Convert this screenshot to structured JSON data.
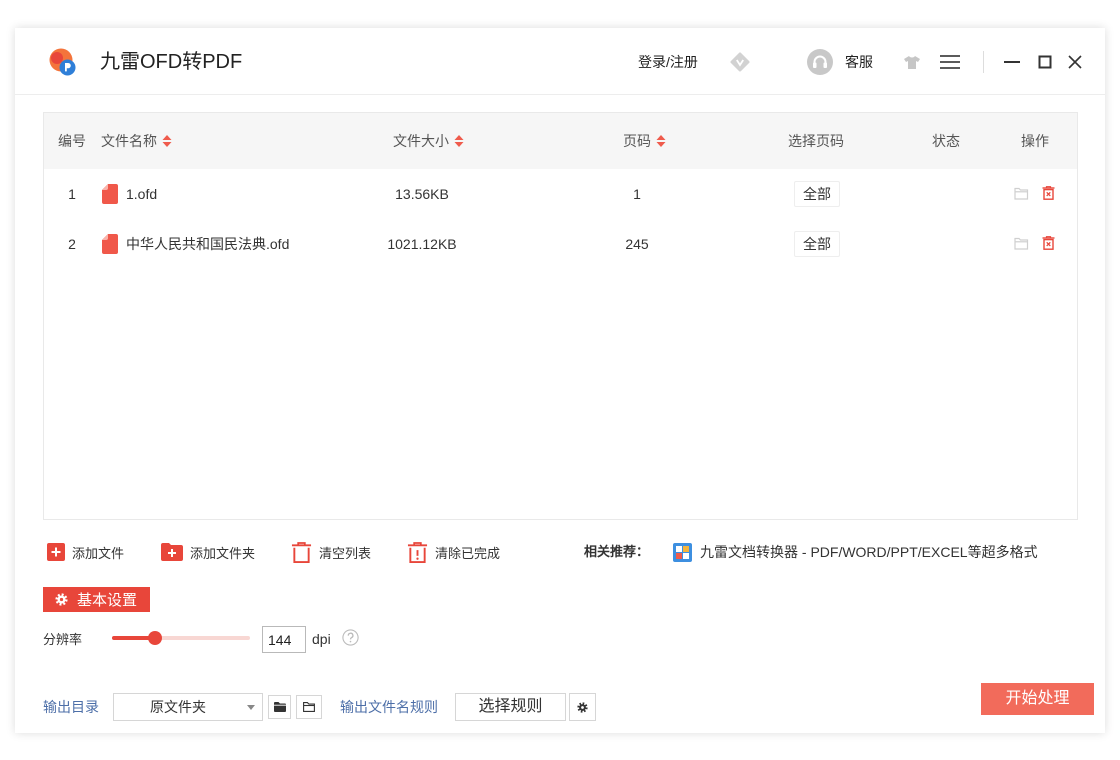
{
  "app": {
    "title": "九雷OFD转PDF",
    "logo_icon": "jiulei-ofd-logo",
    "accent_color": "#e8463a",
    "start_button_color": "#f26b5b",
    "link_color": "#4d6fa8"
  },
  "header": {
    "login_label": "登录/注册",
    "vip_icon": "diamond-vip-icon",
    "service_icon": "headset-icon",
    "service_label": "客服",
    "skin_icon": "tshirt-icon",
    "menu_icon": "menu-icon",
    "window_controls": [
      "minimize-icon",
      "maximize-icon",
      "close-icon"
    ]
  },
  "table": {
    "columns": [
      {
        "label": "编号",
        "sortable": false
      },
      {
        "label": "文件名称",
        "sortable": true
      },
      {
        "label": "文件大小",
        "sortable": true
      },
      {
        "label": "页码",
        "sortable": true
      },
      {
        "label": "选择页码",
        "sortable": false
      },
      {
        "label": "状态",
        "sortable": false
      },
      {
        "label": "操作",
        "sortable": false
      }
    ],
    "rows": [
      {
        "index": "1",
        "name": "1.ofd",
        "size": "13.56KB",
        "pages": "1",
        "page_select": "全部",
        "status": ""
      },
      {
        "index": "2",
        "name": "中华人民共和国民法典.ofd",
        "size": "1021.12KB",
        "pages": "245",
        "page_select": "全部",
        "status": ""
      }
    ],
    "file_icon": "ofd-file-icon",
    "row_action_icons": [
      "open-folder-icon",
      "delete-icon"
    ]
  },
  "toolbar": {
    "add_file": {
      "label": "添加文件",
      "icon": "add-file-icon"
    },
    "add_folder": {
      "label": "添加文件夹",
      "icon": "add-folder-icon"
    },
    "clear_list": {
      "label": "清空列表",
      "icon": "trash-icon"
    },
    "clear_done": {
      "label": "清除已完成",
      "icon": "trash-alert-icon"
    },
    "recommend_label": "相关推荐：",
    "recommend_app": {
      "label": "九雷文档转换器 - PDF/WORD/PPT/EXCEL等超多格式",
      "icon": "doc-converter-app-icon"
    }
  },
  "settings": {
    "section_label": "基本设置",
    "section_icon": "gear-icon",
    "resolution": {
      "label": "分辨率",
      "value": "144",
      "unit": "dpi",
      "slider_level": 0.31,
      "help_icon": "question-circle-icon"
    }
  },
  "output": {
    "dir_label": "输出目录",
    "dir_value": "原文件夹",
    "filename_rule_label": "输出文件名规则",
    "select_rule_label": "选择规则",
    "start_label": "开始处理"
  }
}
